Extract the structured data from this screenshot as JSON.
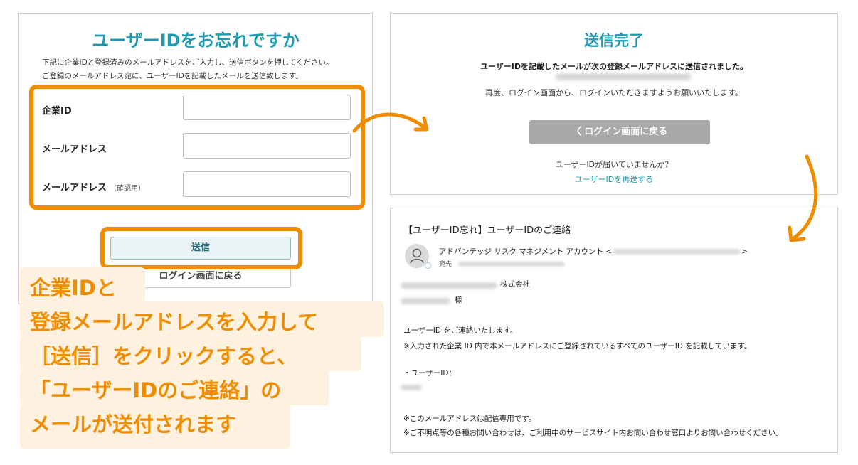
{
  "left_panel": {
    "title": "ユーザーIDをお忘れですか",
    "description_line1": "下記に企業IDと登録済みのメールアドレスをご入力し、送信ボタンを押してください。",
    "description_line2": "ご登録のメールアドレス宛に、ユーザーIDを記載したメールを送信致します。",
    "fields": [
      {
        "label": "企業ID",
        "value": ""
      },
      {
        "label": "メールアドレス",
        "value": ""
      },
      {
        "label": "メールアドレス",
        "note": "（確認用）",
        "value": ""
      }
    ],
    "send_button": "送信",
    "back_button": "ログイン画面に戻る"
  },
  "complete_panel": {
    "title": "送信完了",
    "message1": "ユーザーIDを記載したメールが次の登録メールアドレスに送信されました。",
    "message2": "再度、ログイン画面から、ログインいただきますようお願いいたします。",
    "back_button": "〈 ログイン画面に戻る",
    "not_received": "ユーザーIDが届いていませんか？",
    "resend_link": "ユーザーIDを再送する"
  },
  "email_panel": {
    "subject": "【ユーザーID忘れ】ユーザーIDのご連絡",
    "from_name": "アドバンテッジ リスク マネジメント アカウント <",
    "from_end": ">",
    "to_label": "宛先",
    "company_suffix": "株式会社",
    "honorific": "様",
    "body_line1": "ユーザーID をご連絡いたします。",
    "body_line2": "※入力された企業 ID 内で本メールアドレスにご登録されているすべてのユーザーID を記載しています。",
    "userid_label": "・ユーザーID：",
    "footer1": "※このメールアドレスは配信専用です。",
    "footer2": "※ご不明点等の各種お問い合わせは、ご利用中のサービスサイト内お問い合わせ窓口よりお問い合わせください。"
  },
  "callout": {
    "line1": "企業IDと",
    "line2": "登録メールアドレスを入力して",
    "line3": "［送信］をクリックすると、",
    "line4": "「ユーザーIDのご連絡」の",
    "line5": "メールが送付されます"
  },
  "colors": {
    "accent": "#1f9bb0",
    "highlight": "#f08c00",
    "callout_bg": "#fff1df"
  },
  "icons": [
    "user-avatar-icon",
    "arrow-right-icon",
    "arrow-down-icon"
  ]
}
